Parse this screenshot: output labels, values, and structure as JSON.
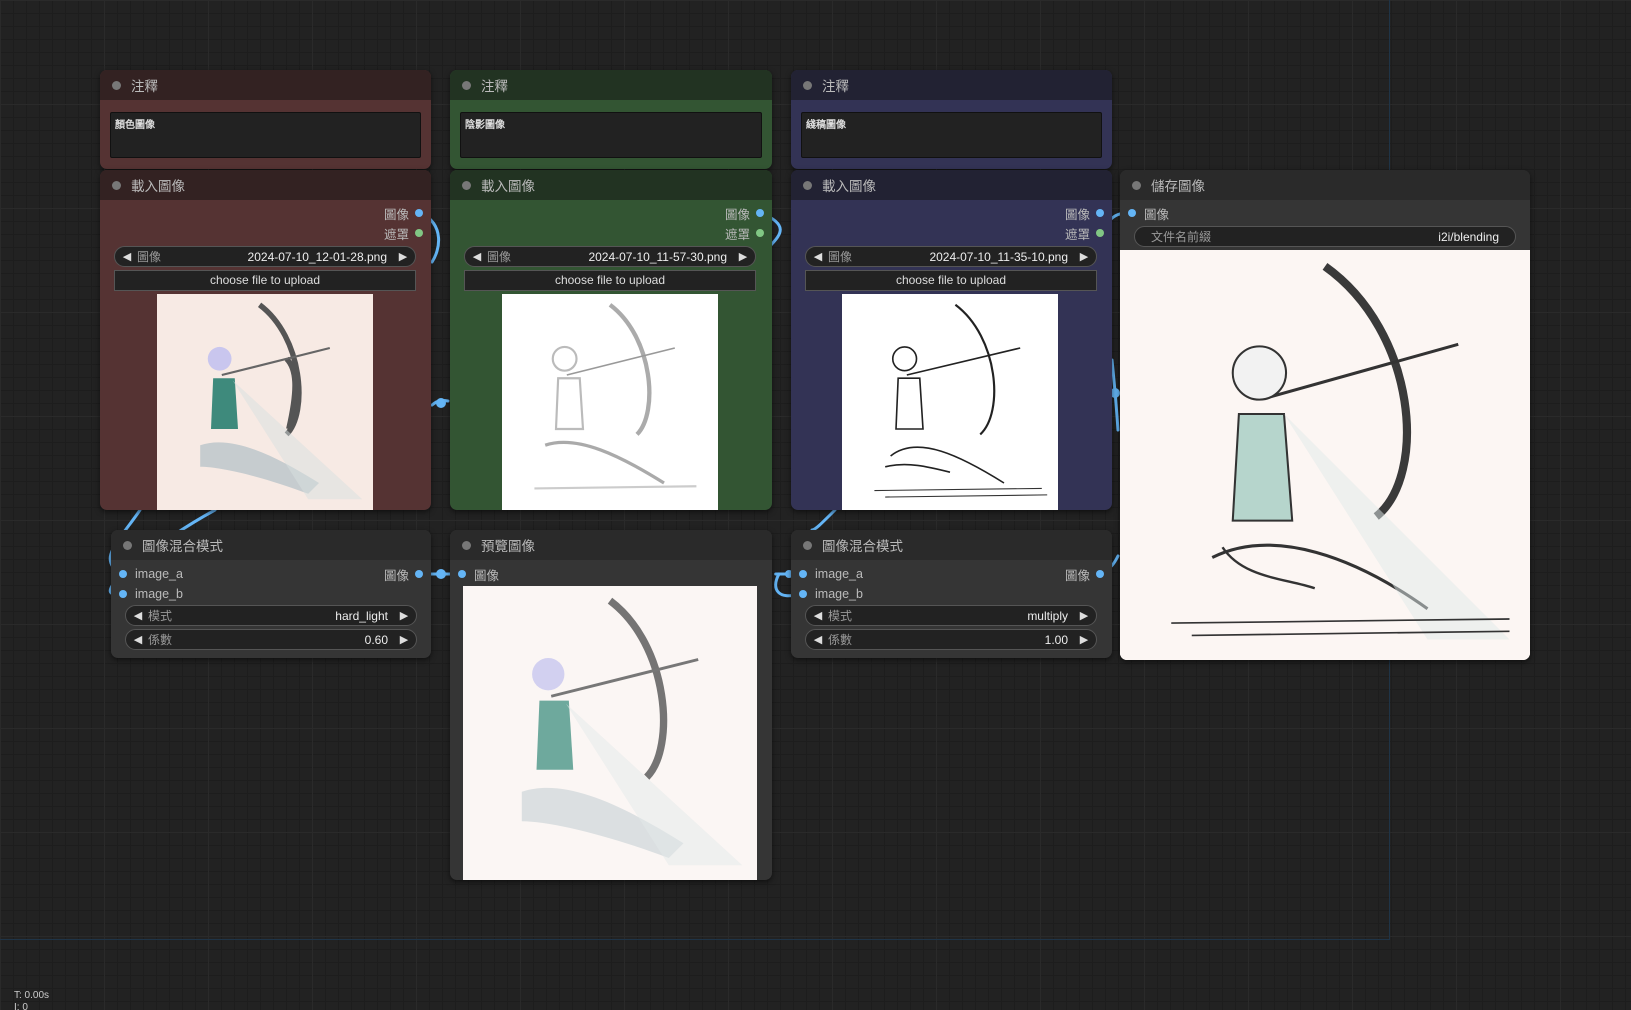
{
  "notes": [
    {
      "title": "注釋",
      "text": "顏色圖像"
    },
    {
      "title": "注釋",
      "text": "陰影圖像"
    },
    {
      "title": "注釋",
      "text": "綫稿圖像"
    }
  ],
  "load_nodes": [
    {
      "title": "載入圖像",
      "out_image": "圖像",
      "out_mask": "遮罩",
      "widget_label": "圖像",
      "widget_value": "2024-07-10_12-01-28.png",
      "upload": "choose file to upload"
    },
    {
      "title": "載入圖像",
      "out_image": "圖像",
      "out_mask": "遮罩",
      "widget_label": "圖像",
      "widget_value": "2024-07-10_11-57-30.png",
      "upload": "choose file to upload"
    },
    {
      "title": "載入圖像",
      "out_image": "圖像",
      "out_mask": "遮罩",
      "widget_label": "圖像",
      "widget_value": "2024-07-10_11-35-10.png",
      "upload": "choose file to upload"
    }
  ],
  "blend_nodes": [
    {
      "title": "圖像混合模式",
      "in_a": "image_a",
      "in_b": "image_b",
      "out": "圖像",
      "mode_label": "模式",
      "mode_value": "hard_light",
      "factor_label": "係數",
      "factor_value": "0.60"
    },
    {
      "title": "圖像混合模式",
      "in_a": "image_a",
      "in_b": "image_b",
      "out": "圖像",
      "mode_label": "模式",
      "mode_value": "multiply",
      "factor_label": "係數",
      "factor_value": "1.00"
    }
  ],
  "preview_node": {
    "title": "預覽圖像",
    "in": "圖像"
  },
  "save_node": {
    "title": "儲存圖像",
    "in": "圖像",
    "prefix_label": "文件名前綴",
    "prefix_value": "i2i/blending"
  },
  "stats": {
    "time": "T: 0.00s",
    "line2": "I: 0"
  },
  "colors": {
    "red_node": "#553333",
    "green_node": "#335533",
    "blue_node": "#333355",
    "wire": "#64b5f6",
    "mask_slot": "#81c784"
  },
  "icons": {
    "arrow_left": "left-arrow-icon",
    "arrow_right": "right-arrow-icon",
    "archer": "archer-illustration"
  }
}
